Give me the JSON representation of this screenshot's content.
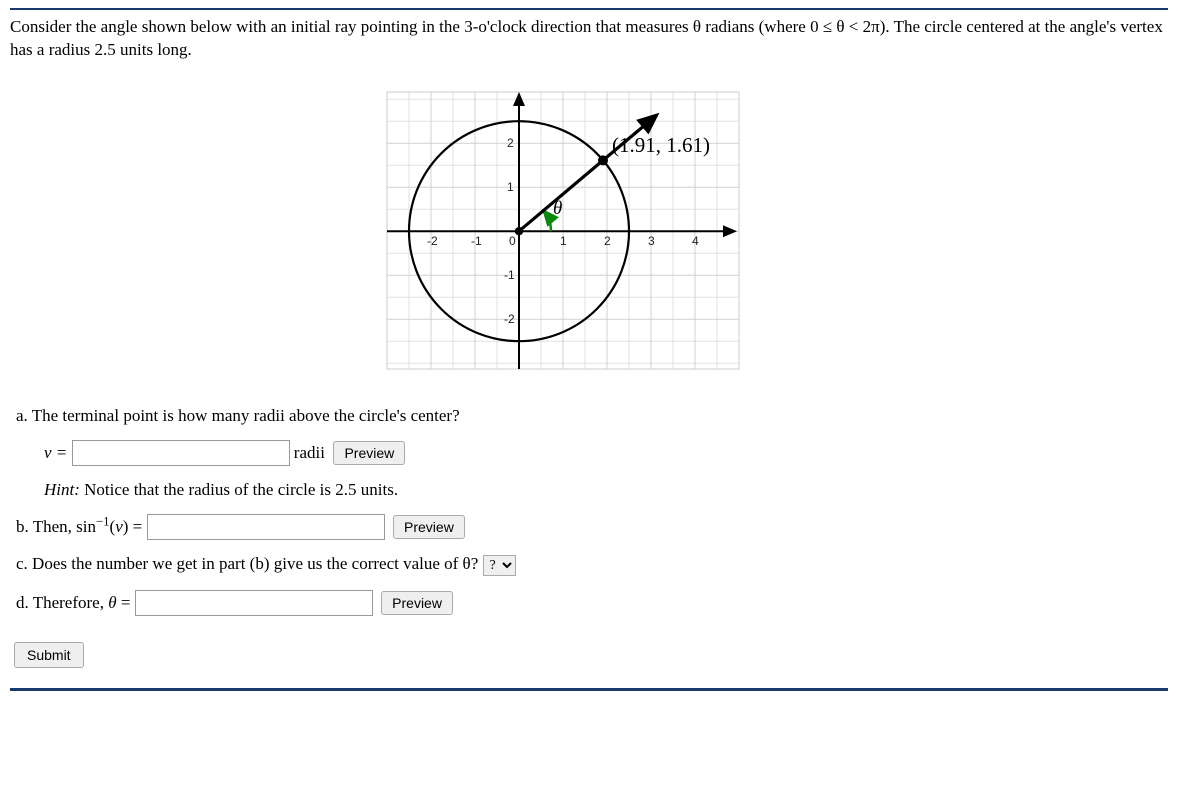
{
  "intro": "Consider the angle shown below with an initial ray pointing in the 3-o'clock direction that measures θ radians (where 0 ≤ θ < 2π). The circle centered at the angle's vertex has a radius 2.5 units long.",
  "chart_data": {
    "type": "diagram",
    "radius": 2.5,
    "terminal_point": [
      1.91,
      1.61
    ],
    "terminal_point_label": "(1.91, 1.61)",
    "theta_label": "θ",
    "xlim": [
      -2.5,
      4.5
    ],
    "ylim": [
      -2.8,
      2.8
    ],
    "x_ticks": [
      -2,
      -1,
      0,
      1,
      2,
      3,
      4
    ],
    "y_ticks": [
      -2,
      -1,
      1,
      2
    ]
  },
  "qa": {
    "a": {
      "text": "a. The terminal point is how many radii above the circle's center?",
      "var": "v =",
      "unit": "radii",
      "preview": "Preview",
      "hint": "Hint: Notice that the radius of the circle is 2.5 units."
    },
    "b": {
      "label_pre": "b. Then, sin",
      "label_exp": "−1",
      "label_post": "(v) = ",
      "preview": "Preview"
    },
    "c": {
      "text_pre": "c. Does the number we get in part (b) give us the correct value of θ?",
      "placeholder": "?"
    },
    "d": {
      "label": "d. Therefore, θ = ",
      "preview": "Preview"
    }
  },
  "submit": "Submit"
}
